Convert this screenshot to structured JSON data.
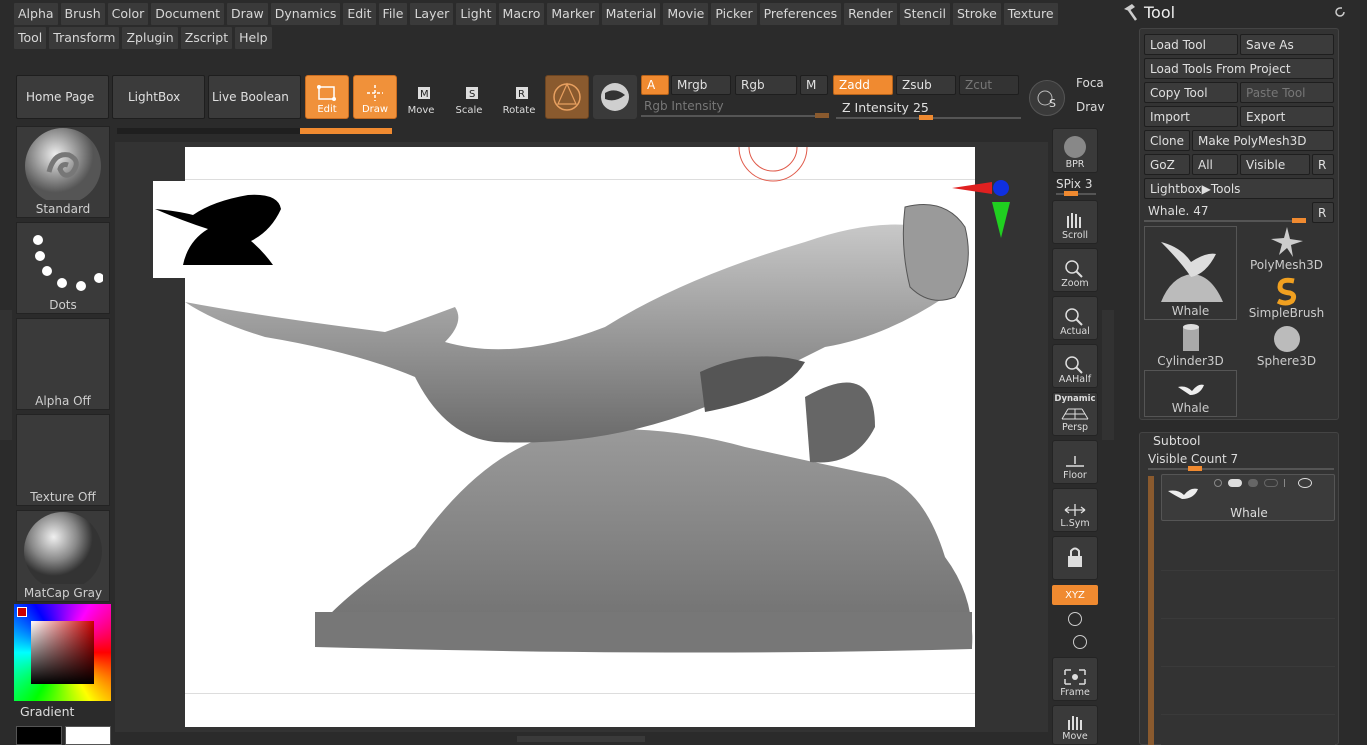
{
  "menu": {
    "row1": [
      "Alpha",
      "Brush",
      "Color",
      "Document",
      "Draw",
      "Dynamics",
      "Edit",
      "File",
      "Layer",
      "Light",
      "Macro",
      "Marker",
      "Material",
      "Movie",
      "Picker",
      "Preferences",
      "Render",
      "Stencil",
      "Stroke",
      "Texture"
    ],
    "row2": [
      "Tool",
      "Transform",
      "Zplugin",
      "Zscript",
      "Help"
    ]
  },
  "nav": {
    "home": "Home Page",
    "lightbox": "LightBox",
    "live_boolean": "Live Boolean"
  },
  "toolbar": {
    "edit": "Edit",
    "draw": "Draw",
    "move": "Move",
    "scale": "Scale",
    "rotate": "Rotate",
    "a": "A",
    "mrgb": "Mrgb",
    "rgb": "Rgb",
    "m": "M",
    "zadd": "Zadd",
    "zsub": "Zsub",
    "zcut": "Zcut",
    "rgb_intensity": "Rgb Intensity",
    "z_intensity_label": "Z Intensity",
    "z_intensity_value": "25",
    "focal": "Foca",
    "draw_size": "Drav",
    "z_intensity_fraction": 0.25
  },
  "left": {
    "brush": "Standard",
    "stroke": "Dots",
    "alpha": "Alpha Off",
    "texture": "Texture Off",
    "material": "MatCap Gray",
    "gradient": "Gradient"
  },
  "right_toolbar": {
    "bpr": "BPR",
    "spix_label": "SPix",
    "spix_value": "3",
    "scroll": "Scroll",
    "zoom": "Zoom",
    "actual": "Actual",
    "aahalf": "AAHalf",
    "dynamic": "Dynamic",
    "persp": "Persp",
    "floor": "Floor",
    "lsym": "L.Sym",
    "xyz": "XYZ",
    "frame": "Frame",
    "move": "Move"
  },
  "tool_panel": {
    "title": "Tool",
    "load_tool": "Load Tool",
    "save_as": "Save As",
    "load_from_project": "Load Tools From Project",
    "copy_tool": "Copy Tool",
    "paste_tool": "Paste Tool",
    "import": "Import",
    "export": "Export",
    "clone": "Clone",
    "make_polymesh": "Make PolyMesh3D",
    "goz": "GoZ",
    "all": "All",
    "visible": "Visible",
    "r": "R",
    "lightbox_tools": "Lightbox▶Tools",
    "current_tool_label": "Whale.",
    "current_tool_value": "47",
    "current_tool_r": "R",
    "tools": [
      "Whale",
      "PolyMesh3D",
      "SimpleBrush",
      "Cylinder3D",
      "Sphere3D",
      "Whale"
    ]
  },
  "subtool": {
    "title": "Subtool",
    "visible_count_label": "Visible Count",
    "visible_count": "7",
    "item_name": "Whale"
  },
  "colors": {
    "accent": "#f08a30",
    "panel": "#3a3a3a",
    "background": "#2b2b2b",
    "canvas": "#ffffff"
  }
}
